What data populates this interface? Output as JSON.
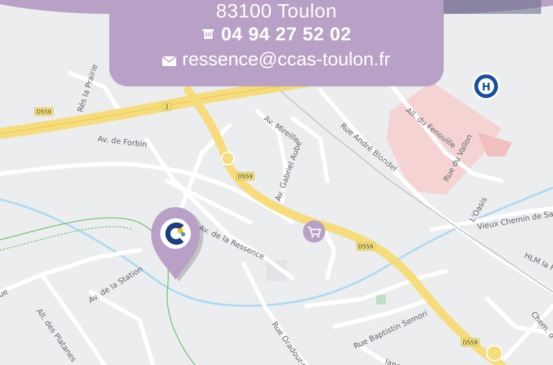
{
  "contact": {
    "city": "83100 Toulon",
    "phone": "04 94 27 52 02",
    "email": "ressence@ccas-toulon.fr",
    "phone_icon": "phone-icon",
    "email_icon": "envelope-icon"
  },
  "colors": {
    "brand_purple": "#b9a0c6",
    "road_yellow": "#f6dc7a",
    "hospital_blue": "#1a4f9c"
  },
  "map": {
    "streets": [
      "Rés la Prairie",
      "Av. de Forbin",
      "Av. Mireille",
      "Av. Gabriel Aube",
      "Rue André Blondel",
      "All. du Fenouille",
      "Rue du Vallon",
      "L'Oasis",
      "Vieux Chemin de Sa",
      "HLM la F",
      "Av. de la Ressence",
      "Av. de la Station",
      "All. des Platanes",
      "Rue Oradour-s",
      "Rue Baptistin Semori",
      "Chem. d",
      "ue",
      "lanc"
    ],
    "shields": [
      "D559",
      "2",
      "D559",
      "D559",
      "D559"
    ],
    "hospital_letter": "H",
    "marker_icon": "ccas-logo-icon",
    "shop_icon": "shopping-cart-icon"
  }
}
